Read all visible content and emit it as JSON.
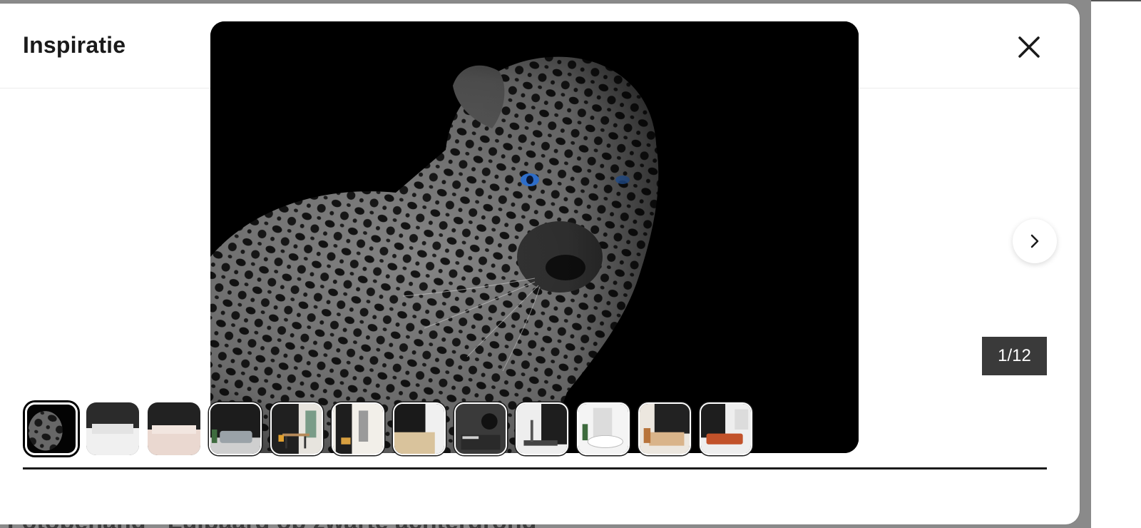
{
  "modal": {
    "title": "Inspiratie",
    "counter": "1/12",
    "main_image_alt": "leopard"
  },
  "backdrop": {
    "page_title": "Fotobehang - Luipaard op zwarte achtergrond"
  },
  "thumbnails": [
    {
      "scene": "leopard"
    },
    {
      "scene": "bedroom-white"
    },
    {
      "scene": "bedroom-pink"
    },
    {
      "scene": "living-sofa"
    },
    {
      "scene": "dining"
    },
    {
      "scene": "hallway"
    },
    {
      "scene": "cabinet"
    },
    {
      "scene": "bathroom-dark"
    },
    {
      "scene": "gym"
    },
    {
      "scene": "bathtub"
    },
    {
      "scene": "bedroom-wood"
    },
    {
      "scene": "orange-sofa"
    }
  ],
  "active_thumbnail": 1,
  "colors": {
    "counter_bg": "#3a3a3a",
    "leopard_eye": "#3a8bff"
  },
  "icons": {
    "close": "close-icon",
    "next": "chevron-right-icon"
  }
}
